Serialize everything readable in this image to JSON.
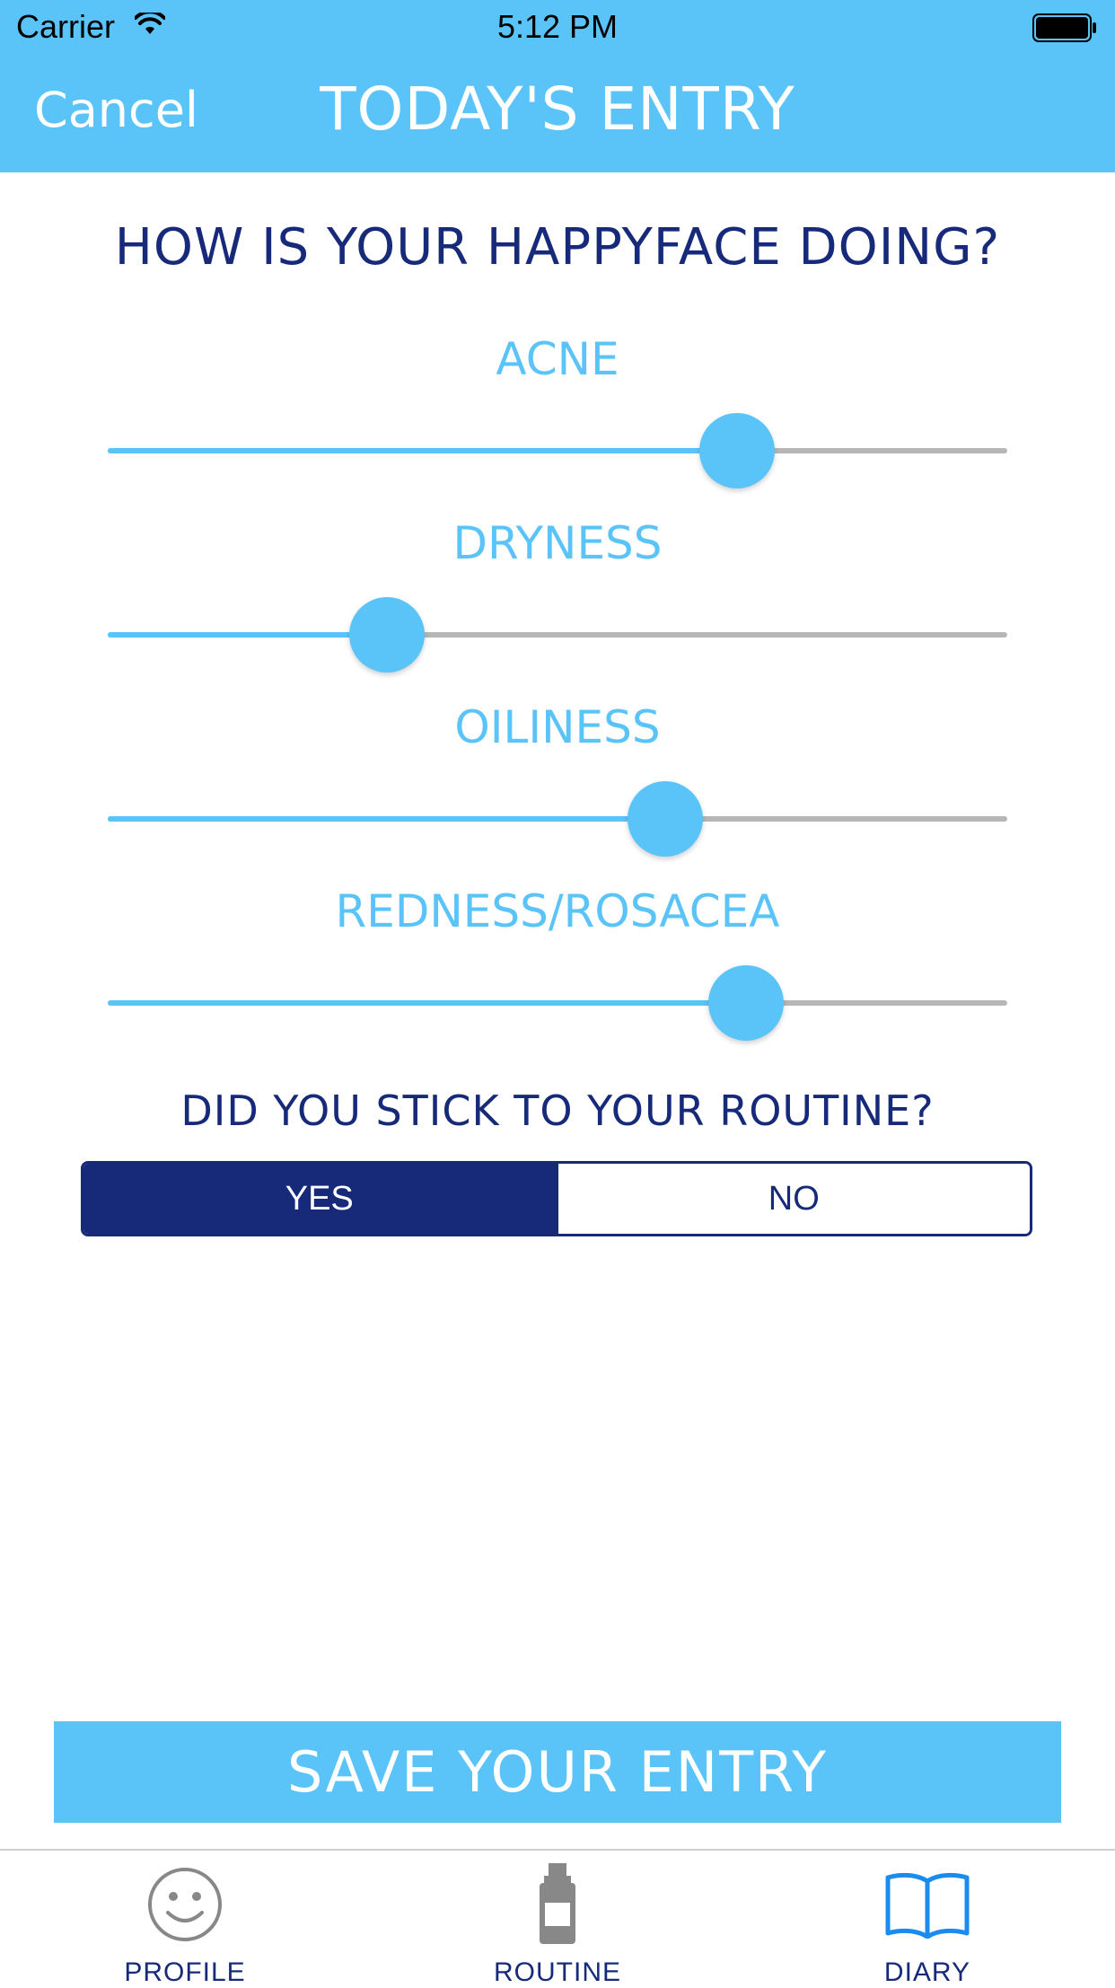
{
  "status_bar": {
    "carrier": "Carrier",
    "time": "5:12 PM",
    "icons": [
      "wifi-icon",
      "battery-icon"
    ]
  },
  "nav_bar": {
    "cancel_label": "Cancel",
    "title": "TODAY'S ENTRY"
  },
  "main": {
    "question": "HOW IS YOUR HAPPYFACE DOING?",
    "sliders": [
      {
        "label": "ACNE",
        "value": 0.7
      },
      {
        "label": "DRYNESS",
        "value": 0.31
      },
      {
        "label": "OILINESS",
        "value": 0.62
      },
      {
        "label": "REDNESS/ROSACEA",
        "value": 0.71
      }
    ],
    "routine_question": "DID YOU STICK TO YOUR ROUTINE?",
    "routine_options": [
      {
        "label": "YES",
        "selected": true
      },
      {
        "label": "NO",
        "selected": false
      }
    ],
    "save_label": "SAVE YOUR ENTRY"
  },
  "tab_bar": {
    "items": [
      {
        "label": "PROFILE",
        "icon": "smiley-face-icon",
        "active": false
      },
      {
        "label": "ROUTINE",
        "icon": "bottle-icon",
        "active": false
      },
      {
        "label": "DIARY",
        "icon": "open-book-icon",
        "active": true
      }
    ]
  },
  "colors": {
    "header_blue": "#5ac4f9",
    "accent_blue": "#5ac4f9",
    "navy": "#172a7a",
    "track_gray": "#b6b6b6",
    "active_tab_blue": "#1a8cf0",
    "inactive_icon_gray": "#888888"
  }
}
